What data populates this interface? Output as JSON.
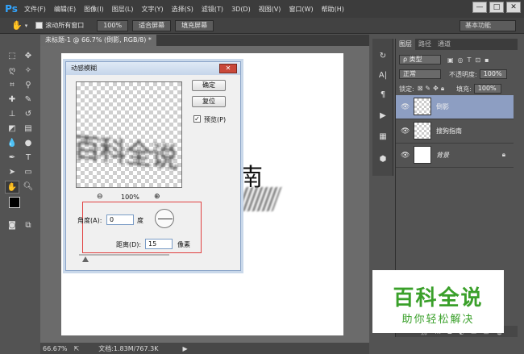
{
  "app": {
    "logo": "Ps"
  },
  "menu": [
    "文件(F)",
    "编辑(E)",
    "图像(I)",
    "图层(L)",
    "文字(Y)",
    "选择(S)",
    "滤镜(T)",
    "3D(D)",
    "视图(V)",
    "窗口(W)",
    "帮助(H)"
  ],
  "window_controls": {
    "minimize": "—",
    "restore": "□",
    "close": "✕"
  },
  "options": {
    "scroll_all_label": "滚动所有窗口",
    "zoom_100": "100%",
    "fit_screen": "适合屏幕",
    "fill_screen": "填充屏幕",
    "workspace": "基本功能"
  },
  "document": {
    "tab_title": "未标题-1 @ 66.7% (倒影, RGB/8) *",
    "canvas_text": "南"
  },
  "status": {
    "zoom": "66.67%",
    "doc_info": "文档:1.83M/767.3K"
  },
  "dialog": {
    "title": "动感模糊",
    "ok": "确定",
    "reset": "复位",
    "preview_label": "预览(P)",
    "preview_checked": true,
    "zoom_out": "⊖",
    "zoom_level": "100%",
    "zoom_in": "⊕",
    "angle_label": "角度(A):",
    "angle_value": "0",
    "angle_unit": "度",
    "distance_label": "距离(D):",
    "distance_value": "15",
    "distance_unit": "像素",
    "preview_text": "百科全说"
  },
  "panels": {
    "tabs": [
      "图层",
      "路径",
      "通道"
    ],
    "kind_filter": "ρ 类型",
    "blend_mode": "正常",
    "opacity_label": "不透明度:",
    "opacity_value": "100%",
    "lock_label": "锁定:",
    "fill_label": "填充:",
    "fill_value": "100%",
    "layers": [
      {
        "name": "倒影",
        "selected": true
      },
      {
        "name": "搜狗指南",
        "selected": false
      },
      {
        "name": "背景",
        "selected": false,
        "locked": true
      }
    ]
  },
  "watermark": {
    "main": "百科全说",
    "sub": "助你轻松解决"
  }
}
